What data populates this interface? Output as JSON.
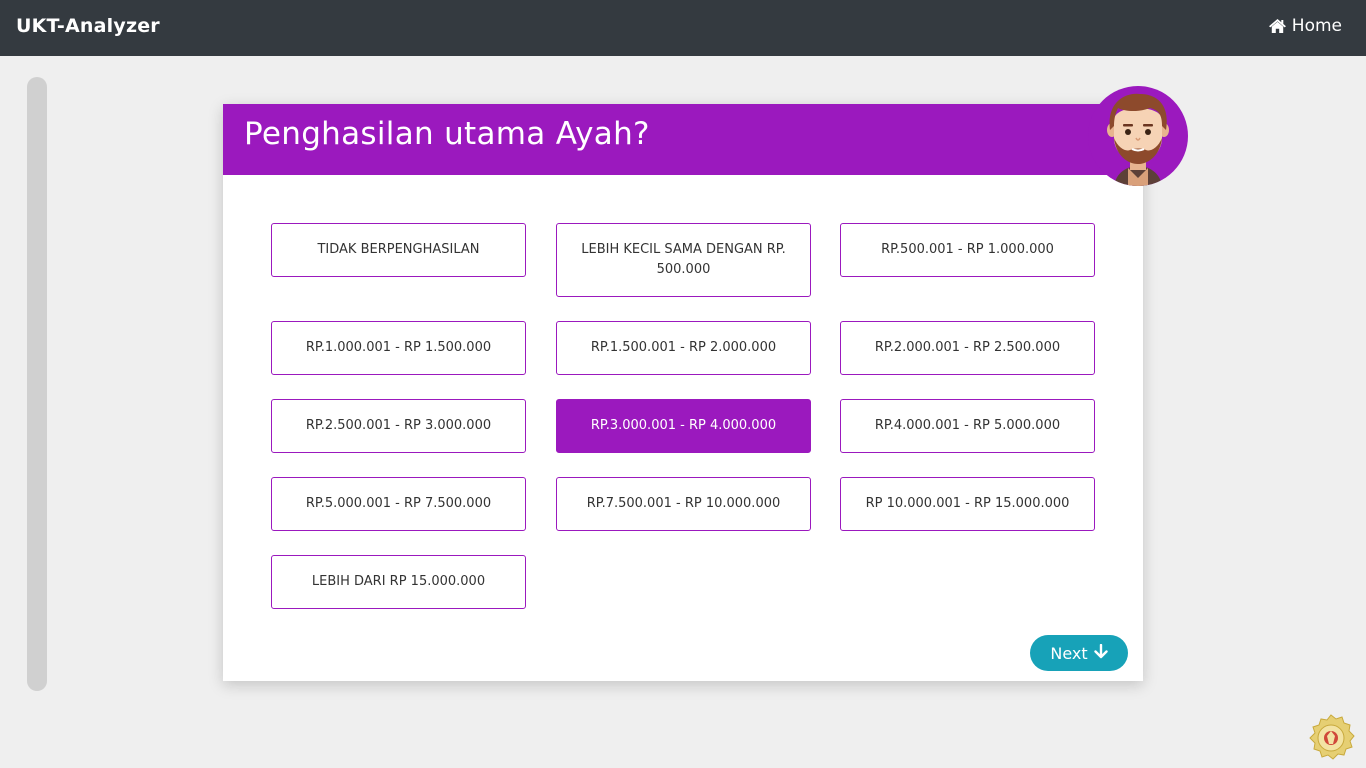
{
  "navbar": {
    "brand": "UKT-Analyzer",
    "home_label": "Home",
    "home_icon": "home-icon"
  },
  "progress": {
    "fraction": 0
  },
  "question": {
    "title": "Penghasilan utama Ayah?",
    "avatar_icon": "male-avatar-icon"
  },
  "options": [
    "TIDAK BERPENGHASILAN",
    "LEBIH KECIL SAMA DENGAN RP. 500.000",
    "RP.500.001 - RP 1.000.000",
    "RP.1.000.001 - RP 1.500.000",
    "RP.1.500.001 - RP 2.000.000",
    "RP.2.000.001 - RP 2.500.000",
    "RP.2.500.001 - RP 3.000.000",
    "RP.3.000.001 - RP 4.000.000",
    "RP.4.000.001 - RP 5.000.000",
    "RP.5.000.001 - RP 7.500.000",
    "RP.7.500.001 - RP 10.000.000",
    "RP 10.000.001 - RP 15.000.000",
    "LEBIH DARI RP 15.000.000"
  ],
  "selected_option": "RP.3.000.001 - RP 4.000.000",
  "next_button": {
    "label": "Next",
    "icon": "arrow-down-icon"
  },
  "colors": {
    "accent": "#9b19be",
    "navbar": "#343a40",
    "next_button": "#17a2b8",
    "background": "#efefef"
  },
  "footer": {
    "seal_icon": "university-seal-icon"
  }
}
